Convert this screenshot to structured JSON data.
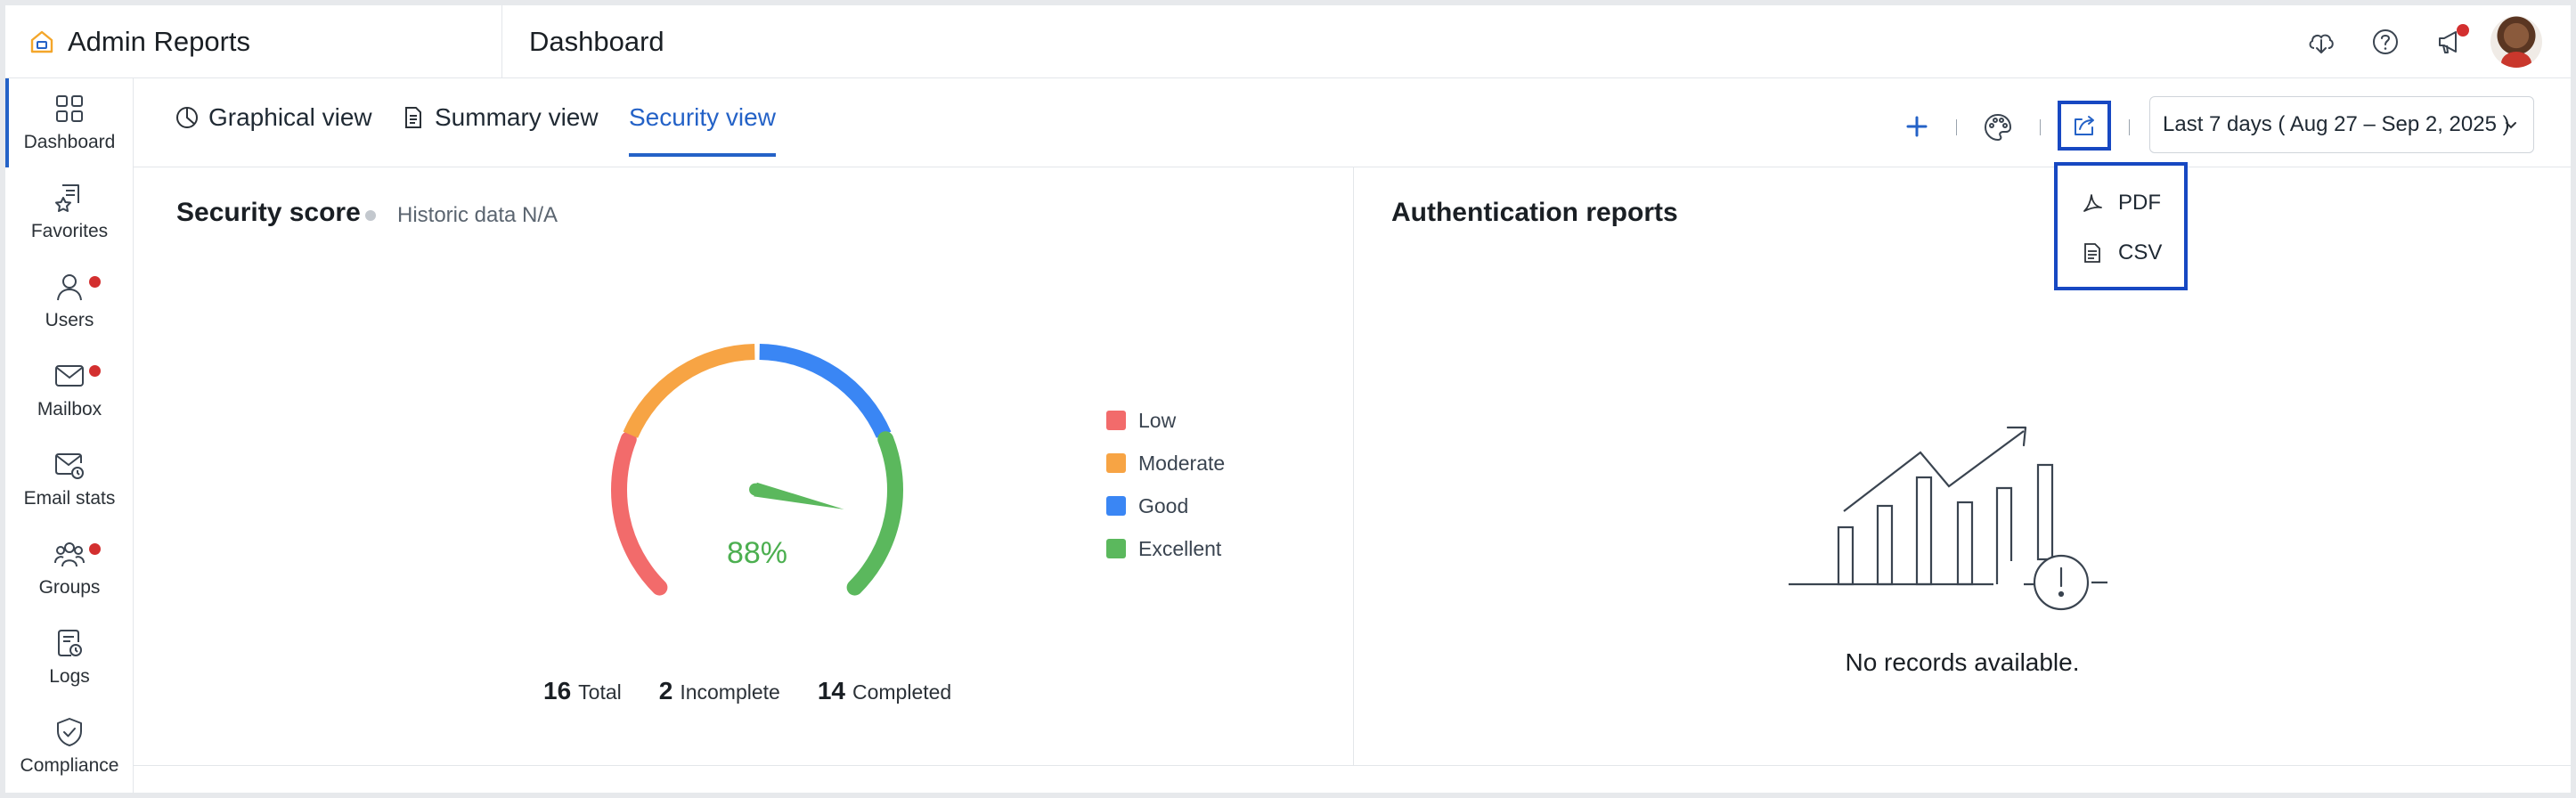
{
  "header": {
    "app_title": "Admin Reports",
    "page_title": "Dashboard",
    "actions": [
      {
        "name": "download-icon"
      },
      {
        "name": "help-icon"
      },
      {
        "name": "announcement-icon",
        "has_dot": true
      },
      {
        "name": "avatar"
      }
    ]
  },
  "sidebar": {
    "items": [
      {
        "label": "Dashboard",
        "icon": "dashboard-grid-icon",
        "active": true,
        "dot": false
      },
      {
        "label": "Favorites",
        "icon": "favorites-icon",
        "active": false,
        "dot": false
      },
      {
        "label": "Users",
        "icon": "user-icon",
        "active": false,
        "dot": true
      },
      {
        "label": "Mailbox",
        "icon": "mail-icon",
        "active": false,
        "dot": true
      },
      {
        "label": "Email stats",
        "icon": "email-stats-icon",
        "active": false,
        "dot": false
      },
      {
        "label": "Groups",
        "icon": "groups-icon",
        "active": false,
        "dot": true
      },
      {
        "label": "Logs",
        "icon": "logs-icon",
        "active": false,
        "dot": false
      },
      {
        "label": "Compliance",
        "icon": "shield-check-icon",
        "active": false,
        "dot": false
      }
    ]
  },
  "tabs": [
    {
      "label": "Graphical view",
      "icon": "pie-chart-icon",
      "active": false
    },
    {
      "label": "Summary view",
      "icon": "document-icon",
      "active": false
    },
    {
      "label": "Security view",
      "active": true
    }
  ],
  "toolbar": {
    "date_range": "Last 7 days ( Aug 27 – Sep 2, 2025 )",
    "export_menu": [
      {
        "label": "PDF",
        "icon": "pdf-icon"
      },
      {
        "label": "CSV",
        "icon": "csv-icon"
      }
    ]
  },
  "security_score": {
    "title": "Security score",
    "meta": "Historic data N/A",
    "percent": "88%",
    "value": 88,
    "legend": [
      {
        "label": "Low",
        "color": "#f26b6b"
      },
      {
        "label": "Moderate",
        "color": "#f7a444"
      },
      {
        "label": "Good",
        "color": "#3a86f4"
      },
      {
        "label": "Excellent",
        "color": "#5bb85d"
      }
    ],
    "stats": [
      {
        "value": "16",
        "label": "Total"
      },
      {
        "value": "2",
        "label": "Incomplete"
      },
      {
        "value": "14",
        "label": "Completed"
      }
    ]
  },
  "authentication_reports": {
    "title": "Authentication reports",
    "empty_message": "No records available."
  },
  "colors": {
    "accent": "#2462c7",
    "highlight_border": "#1748c2",
    "notification": "#d32f2f",
    "gauge_text": "#4caf50"
  }
}
